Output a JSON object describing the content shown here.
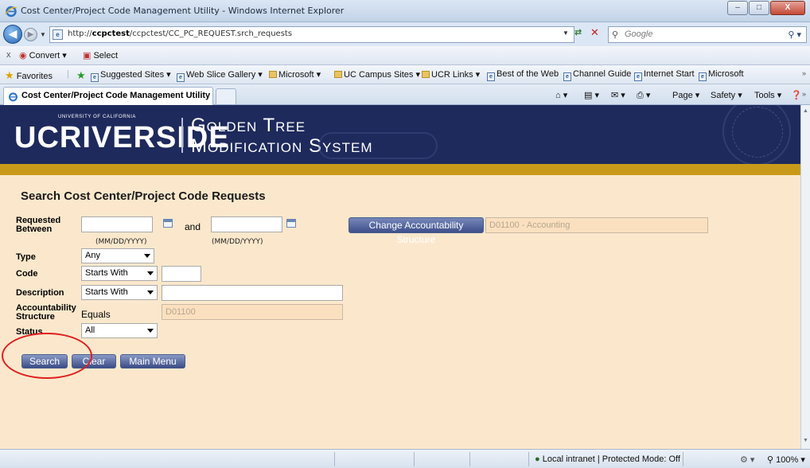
{
  "window": {
    "title": "Cost Center/Project Code Management Utility - Windows Internet Explorer",
    "min": "–",
    "max": "□",
    "close": "X"
  },
  "address": {
    "url_prefix": "http://",
    "url_host": "ccpctest",
    "url_path": "/ccpctest/CC_PC_REQUEST.srch_requests",
    "search_placeholder": "Google"
  },
  "commandbar": {
    "close": "x",
    "convert": "Convert",
    "select": "Select"
  },
  "favorites": {
    "label": "Favorites",
    "items": [
      "Suggested Sites ▾",
      "Web Slice Gallery ▾",
      "Microsoft ▾",
      "UC Campus Sites ▾",
      "UCR Links ▾",
      "Best of the Web",
      "Channel Guide",
      "Internet Start",
      "Microsoft"
    ]
  },
  "tabbar": {
    "tab_label": "Cost Center/Project Code Management Utility",
    "page": "Page ▾",
    "safety": "Safety ▾",
    "tools": "Tools ▾"
  },
  "banner": {
    "uc": "UCRIVERSIDE",
    "uc_small": "UNIVERSITY OF CALIFORNIA",
    "line1": "Golden Tree",
    "line2": "Modification System"
  },
  "form": {
    "heading": "Search Cost Center/Project Code Requests",
    "requested_between_label_1": "Requested",
    "requested_between_label_2": "Between",
    "from_date": "",
    "to_date": "",
    "and_label": "and",
    "date_hint": "(MM/DD/YYYY)",
    "type_label": "Type",
    "type_value": "Any",
    "code_label": "Code",
    "code_operator": "Starts With",
    "code_value": "",
    "description_label": "Description",
    "description_operator": "Starts With",
    "description_value": "",
    "acct_label_1": "Accountability",
    "acct_label_2": "Structure",
    "acct_operator": "Equals",
    "acct_value": "D01100",
    "status_label": "Status",
    "status_value": "All",
    "change_acct_button": "Change Accountability Structure",
    "acct_display": "D01100 - Accounting"
  },
  "buttons": {
    "search": "Search",
    "clear": "Clear",
    "main_menu": "Main Menu"
  },
  "status": {
    "zone": "Local intranet | Protected Mode: Off",
    "zoom": "100%"
  },
  "colors": {
    "banner": "#1e2a5c",
    "gold": "#c99a1a",
    "content_bg": "#fbe8cc",
    "button": "#3c4c86",
    "annotation": "#e01e1e"
  }
}
